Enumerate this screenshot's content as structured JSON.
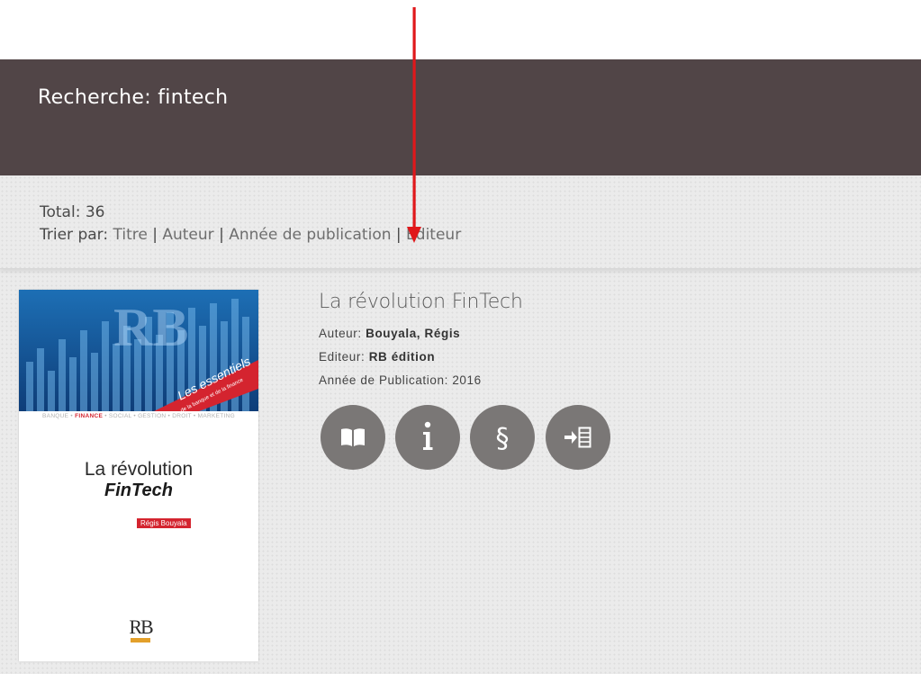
{
  "header": {
    "search_label": "Recherche: fintech"
  },
  "results_meta": {
    "total_label": "Total: 36",
    "sort_label": "Trier par:",
    "sort_options": [
      "Titre",
      "Auteur",
      "Année de publication",
      "Editeur"
    ],
    "separator": "|"
  },
  "result": {
    "title": "La révolution FinTech",
    "author_label": "Auteur:",
    "author": "Bouyala, Régis",
    "editor_label": "Editeur:",
    "editor": "RB édition",
    "year_label": "Année de Publication:",
    "year": "2016",
    "actions": [
      {
        "name": "read",
        "icon": "open-book-icon"
      },
      {
        "name": "info",
        "icon": "info-icon"
      },
      {
        "name": "loan",
        "icon": "section-sign-icon"
      },
      {
        "name": "add-to-list",
        "icon": "add-to-list-icon"
      }
    ],
    "cover": {
      "series": "Les essentiels",
      "series_sub": "de la banque et de la finance",
      "topics_before": "BANQUE • ",
      "topics_highlight": "FINANCE",
      "topics_after": " • SOCIAL • GESTION • DROIT • MARKETING",
      "title_line1": "La révolution",
      "title_line2": "FinTech",
      "author": "Régis Bouyala",
      "logo": "RB"
    }
  },
  "colors": {
    "header_bg": "#514547",
    "content_bg": "#ebebeb",
    "button_bg": "#7a7776",
    "annotation_arrow": "#e0181b",
    "cover_accent": "#d4242f"
  }
}
